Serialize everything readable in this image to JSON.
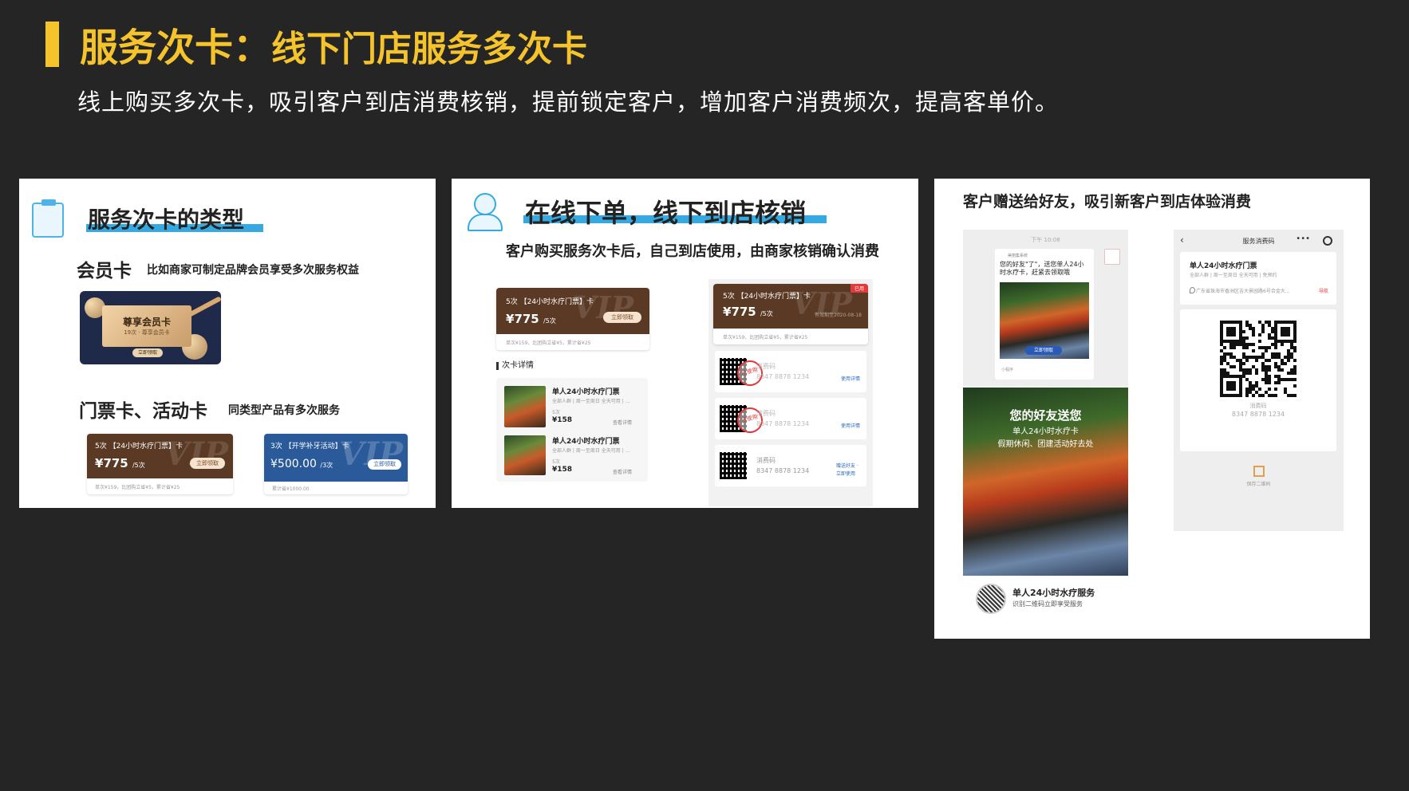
{
  "header": {
    "title_main": "服务次卡：",
    "title_sub": "线下门店服务多次卡",
    "subtitle": "线上购买多次卡，吸引客户到店消费核销，提前锁定客户，增加客户消费频次，提高客单价。"
  },
  "panel_types": {
    "heading": "服务次卡的类型",
    "member_label": "会员卡",
    "member_desc": "比如商家可制定品牌会员享受多次服务权益",
    "member_card": {
      "title": "尊享会员卡",
      "sub": "19次 · 尊享会员卡",
      "btn": "立即领取"
    },
    "ticket_label": "门票卡、活动卡",
    "ticket_desc": "同类型产品有多次服务",
    "coupon_brown": {
      "head": "5次 【24小时水疗门票】卡",
      "price": "775",
      "unit": "/5次",
      "btn": "立即领取",
      "foot": "单次¥159，比团购立省¥5，累计省¥25"
    },
    "coupon_blue": {
      "head": "3次 【开学补牙活动】卡",
      "price": "500.00",
      "unit": "/3次",
      "btn": "立即领取",
      "foot": "累计省¥1000.00"
    }
  },
  "panel_order": {
    "heading": "在线下单，线下到店核销",
    "desc": "客户购买服务次卡后，自己到店使用，由商家核销确认消费",
    "coupon": {
      "head": "5次 【24小时水疗门票】卡",
      "price": "775",
      "unit": "/5次",
      "btn": "立即领取",
      "foot": "单次¥159，比团购立省¥5，累计省¥25"
    },
    "detail_title": "次卡详情",
    "detail_items": [
      {
        "title": "单人24小时水疗门票",
        "sub": "全部人群 | 周一至周日 全天可用 | ...",
        "count": "5次",
        "price": "¥158",
        "link": "查看详情"
      },
      {
        "title": "单人24小时水疗门票",
        "sub": "全部人群 | 周一至周日 全天可用 | ...",
        "count": "5次",
        "price": "¥158",
        "link": "查看详情"
      }
    ],
    "right_coupon": {
      "head": "5次 【24小时水疗门票】卡",
      "price": "775",
      "unit": "/5次",
      "tag": "已用",
      "date": "有效期至2020-08-18",
      "foot": "单次¥159，比团购立省¥5，累计省¥25"
    },
    "codes": [
      {
        "label": "消费码",
        "code": "8347 8878 1234",
        "action": "使用详情",
        "stamp": "已使用"
      },
      {
        "label": "消费码",
        "code": "8347 8878 1234",
        "action": "使用详情",
        "stamp": "已使用"
      },
      {
        "label": "消费码",
        "code": "8347 8878 1234",
        "action": "赠送好友 · 立即使用",
        "stamp": ""
      }
    ]
  },
  "panel_gift": {
    "heading": "客户赠送给好友，吸引新客户到店体验消费",
    "chat_time": "下午 10:08",
    "chat_sender": "美丽集系统",
    "chat_text": "您的好友\"了\"，送您单人24小时水疗卡，赶紧去领取哦",
    "chat_btn": "立即领取",
    "chat_mini": "小程序",
    "poster_title": "您的好友送您",
    "poster_line1": "单人24小时水疗卡",
    "poster_line2": "假期休闲、团建活动好去处",
    "share_title": "单人24小时水疗服务",
    "share_sub": "识别二维码立即享受服务",
    "code_page_title": "服务消费码",
    "code_page_item": "单人24小时水疗门票",
    "code_page_item_sub": "全部人群 | 周一至周日 全天可用 | 免预约",
    "code_page_addr": "广东省珠海市香洲区吉大景园路6号合金大...",
    "code_page_nav": "导航",
    "code_label": "消费码",
    "code_value": "8347 8878 1234",
    "save_label": "保存二维码"
  },
  "colors": {
    "accent": "#f5c32c",
    "highlight": "#36a9e1",
    "coupon_brown": "#5a3a24",
    "coupon_blue": "#2a5a9a"
  }
}
